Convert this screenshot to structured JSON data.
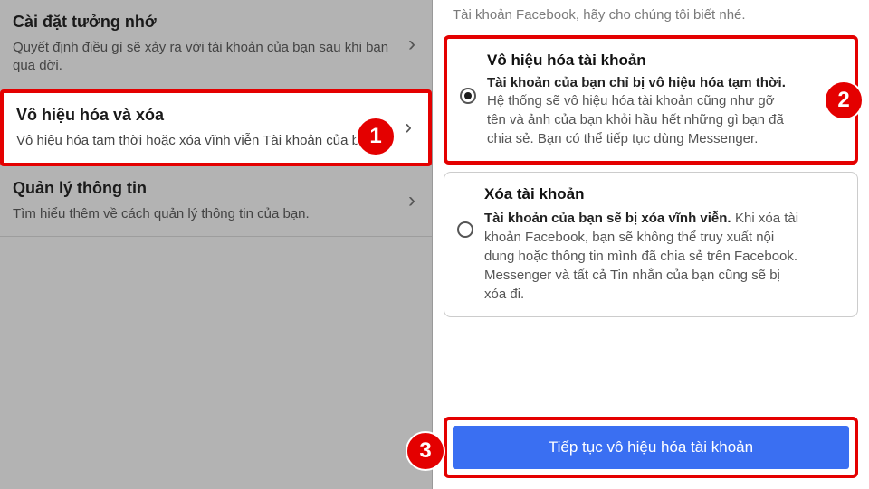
{
  "left_panel": {
    "item1": {
      "title": "Cài đặt tưởng nhớ",
      "desc": "Quyết định điều gì sẽ xảy ra với tài khoản của bạn sau khi bạn qua đời."
    },
    "item2": {
      "title": "Vô hiệu hóa và xóa",
      "desc": "Vô hiệu hóa tạm thời hoặc xóa vĩnh viễn Tài khoản của bạn."
    },
    "item3": {
      "title": "Quản lý thông tin",
      "desc": "Tìm hiểu thêm về cách quản lý thông tin của bạn."
    }
  },
  "right_panel": {
    "top_text": "Tài khoản Facebook, hãy cho chúng tôi biết nhé.",
    "option1": {
      "title": "Vô hiệu hóa tài khoản",
      "lead": "Tài khoản của bạn chỉ bị vô hiệu hóa tạm thời.",
      "body": " Hệ thống sẽ vô hiệu hóa tài khoản cũng như gỡ tên và ảnh của bạn khỏi hầu hết những gì bạn đã chia sẻ. Bạn có thể tiếp tục dùng Messenger."
    },
    "option2": {
      "title": "Xóa tài khoản",
      "lead": "Tài khoản của bạn sẽ bị xóa vĩnh viễn.",
      "body": " Khi xóa tài khoản Facebook, bạn sẽ không thể truy xuất nội dung hoặc thông tin mình đã chia sẻ trên Facebook. Messenger và tất cả Tin nhắn của bạn cũng sẽ bị xóa đi."
    },
    "continue_button": "Tiếp tục vô hiệu hóa tài khoản"
  },
  "badges": {
    "b1": "1",
    "b2": "2",
    "b3": "3"
  }
}
